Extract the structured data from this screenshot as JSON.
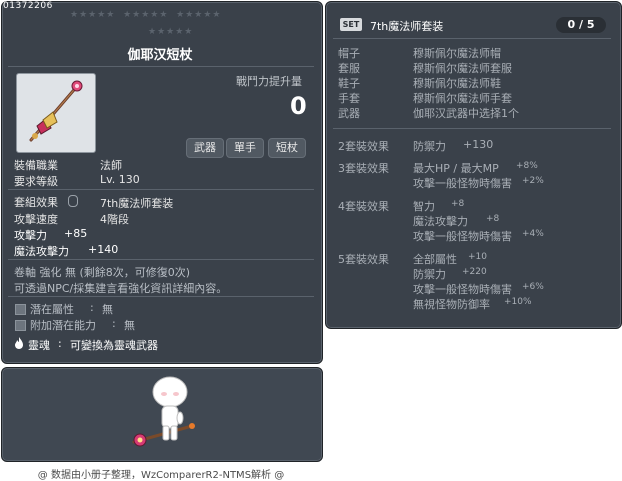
{
  "item": {
    "id": "01372206",
    "title": "伽耶汉短杖",
    "power_label": "戰鬥力提升量",
    "power_value": "0",
    "tags": [
      "武器",
      "單手",
      "短杖"
    ],
    "job_label": "裝備職業",
    "job_value": "法師",
    "level_label": "要求等級",
    "level_value": "Lv. 130",
    "set_label": "套組效果",
    "set_value": "7th魔法师套装",
    "speed_label": "攻擊速度",
    "speed_value": "4階段",
    "atk_label": "攻擊力",
    "atk_value": "+85",
    "matk_label": "魔法攻擊力",
    "matk_value": "+140",
    "scroll_line": "卷軸 強化 無 (剩餘8次，可修復0次)",
    "scroll_note": "可透過NPC/採集建言看強化資訊詳細內容。",
    "potential_label": "潛在屬性",
    "potential_sep": ":",
    "potential_value": "無",
    "addpot_label": "附加潛在能力",
    "addpot_sep": ":",
    "addpot_value": "無",
    "soul_label": "靈魂",
    "soul_sep": ":",
    "soul_value": "可變換為靈魂武器"
  },
  "set": {
    "badge": "SET",
    "title": "7th魔法师套装",
    "count": "0 / 5",
    "pieces": [
      {
        "slot": "帽子",
        "name": "穆斯佩尔魔法师帽"
      },
      {
        "slot": "套服",
        "name": "穆斯佩尔魔法师套服"
      },
      {
        "slot": "鞋子",
        "name": "穆斯佩尔魔法师鞋"
      },
      {
        "slot": "手套",
        "name": "穆斯佩尔魔法师手套"
      },
      {
        "slot": "武器",
        "name": "伽耶汉武器中选择1个"
      }
    ],
    "effects": [
      {
        "label": "2套裝效果",
        "lines": [
          {
            "stat": "防禦力",
            "value": "+130"
          }
        ]
      },
      {
        "label": "3套裝效果",
        "lines": [
          {
            "stat": "最大HP / 最大MP",
            "value": "+8%"
          },
          {
            "stat": "攻擊一般怪物時傷害",
            "value": "+2%"
          }
        ]
      },
      {
        "label": "4套裝效果",
        "lines": [
          {
            "stat": "智力",
            "value": "+8"
          },
          {
            "stat": "魔法攻擊力",
            "value": "+8"
          },
          {
            "stat": "攻擊一般怪物時傷害",
            "value": "+4%"
          }
        ]
      },
      {
        "label": "5套裝效果",
        "lines": [
          {
            "stat": "全部屬性",
            "value": "+10"
          },
          {
            "stat": "防禦力",
            "value": "+220"
          },
          {
            "stat": "攻擊一般怪物時傷害",
            "value": "+6%"
          },
          {
            "stat": "無視怪物防御率",
            "value": "+10%"
          }
        ]
      }
    ]
  },
  "footer": "@ 数据由小册子整理，WzComparerR2-NTMS解析 @",
  "colors": {
    "panel": "#3a414a",
    "border": "#202428",
    "text": "#e6e6e6",
    "muted": "#a9afb6"
  }
}
